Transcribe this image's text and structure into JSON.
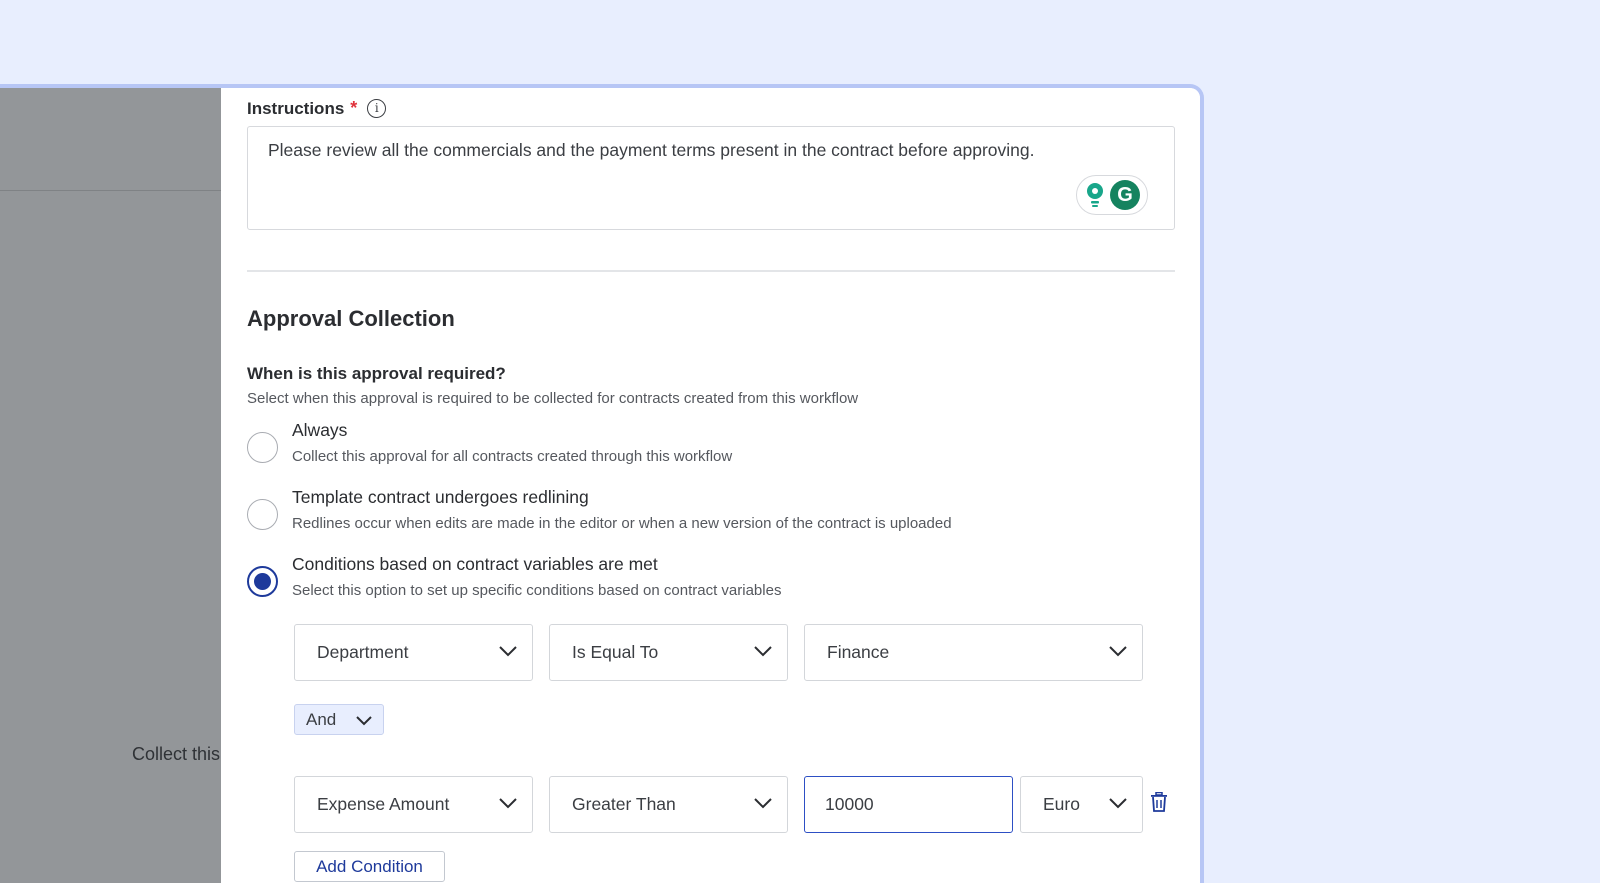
{
  "backdrop": {
    "text": "Collect this approval"
  },
  "instructions": {
    "label": "Instructions",
    "required_mark": "*",
    "value": "Please review all the commercials and the payment terms present in the contract before approving."
  },
  "section": {
    "title": "Approval Collection",
    "question": "When is this approval required?",
    "question_sub": "Select when this approval is required to be collected for contracts created from this workflow"
  },
  "options": [
    {
      "title": "Always",
      "desc": "Collect this approval for all contracts created through this workflow",
      "selected": false
    },
    {
      "title": "Template contract undergoes redlining",
      "desc": "Redlines occur when edits are made in the editor or when a new version of the contract is uploaded",
      "selected": false
    },
    {
      "title": "Conditions based on contract variables are met",
      "desc": "Select this option to set up specific conditions based on contract variables",
      "selected": true
    }
  ],
  "conditions": [
    {
      "variable": "Department",
      "operator": "Is Equal To",
      "value": "Finance"
    },
    {
      "variable": "Expense Amount",
      "operator": "Greater Than",
      "value": "10000",
      "unit": "Euro"
    }
  ],
  "connector": "And",
  "add_condition_label": "Add Condition",
  "colors": {
    "accent": "#1e3a9b",
    "frame": "#b7c6f5",
    "background": "#e8eefe"
  }
}
